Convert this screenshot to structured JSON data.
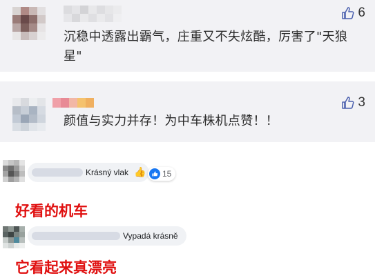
{
  "comment1": {
    "text": "沉稳中透露出霸气，庄重又不失炫酷，厉害了\"天狼星\"",
    "likes": "6",
    "like_icon": "thumbs-up-icon"
  },
  "comment2": {
    "text": "颜值与实力并存！为中车株机点赞！！",
    "likes": "3",
    "like_icon": "thumbs-up-icon"
  },
  "fb1": {
    "text": "Krásný vlak",
    "emoji": "👍",
    "reaction_count": "15",
    "reaction_icon": "like-reaction-icon"
  },
  "caption1": "好看的机车",
  "fb2": {
    "text": "Vypadá krásně"
  },
  "caption2": "它看起来真漂亮",
  "colors": {
    "card_bg": "#f2f2f5",
    "caption_red": "#e01010",
    "fb_bubble": "#f0f2f5",
    "fb_blue": "#1877f2"
  }
}
